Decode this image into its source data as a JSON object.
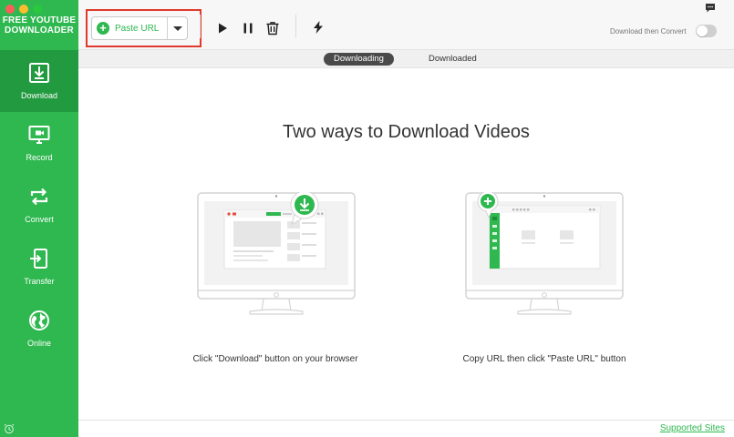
{
  "app": {
    "logo_line1": "FREE YOUTUBE",
    "logo_line2": "DOWNLOADER"
  },
  "sidebar": {
    "items": [
      {
        "label": "Download",
        "icon": "download-icon",
        "active": true
      },
      {
        "label": "Record",
        "icon": "monitor-record-icon",
        "active": false
      },
      {
        "label": "Convert",
        "icon": "convert-icon",
        "active": false
      },
      {
        "label": "Transfer",
        "icon": "transfer-icon",
        "active": false
      },
      {
        "label": "Online",
        "icon": "globe-icon",
        "active": false
      }
    ]
  },
  "toolbar": {
    "paste_label": "Paste URL",
    "convert_label": "Download then Convert",
    "convert_enabled": false,
    "tools": [
      "play-icon",
      "pause-icon",
      "trash-icon",
      "lightning-icon"
    ]
  },
  "tabs": [
    {
      "label": "Downloading",
      "active": true
    },
    {
      "label": "Downloaded",
      "active": false
    }
  ],
  "main": {
    "headline": "Two ways to Download Videos",
    "way1_caption": "Click \"Download\" button on your browser",
    "way2_caption": "Copy URL then click \"Paste URL\" button"
  },
  "footer": {
    "link": "Supported Sites"
  },
  "colors": {
    "brand_green": "#2eb84f",
    "sidebar_active": "#229a3f",
    "highlight_red": "#e03a2e"
  }
}
